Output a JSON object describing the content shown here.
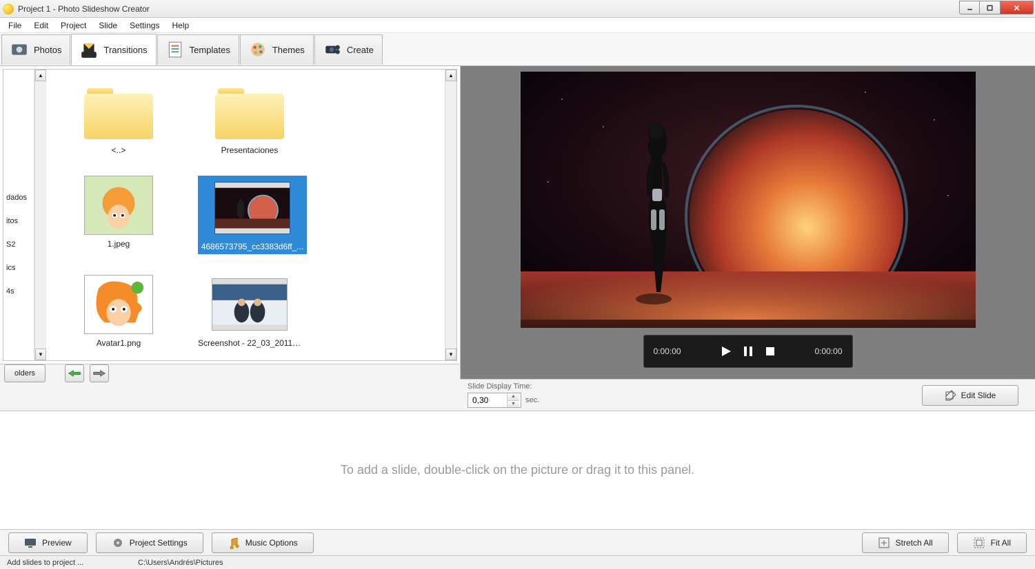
{
  "window": {
    "title": "Project 1 - Photo Slideshow Creator"
  },
  "menu": {
    "items": [
      "File",
      "Edit",
      "Project",
      "Slide",
      "Settings",
      "Help"
    ]
  },
  "tabs": [
    {
      "label": "Photos",
      "active": false
    },
    {
      "label": "Transitions",
      "active": true
    },
    {
      "label": "Templates",
      "active": false
    },
    {
      "label": "Themes",
      "active": false
    },
    {
      "label": "Create",
      "active": false
    }
  ],
  "sidebar_folders": [
    "dados",
    "itos",
    "S2",
    "ics",
    "4s"
  ],
  "files": [
    {
      "label": "<..>",
      "type": "folder",
      "selected": false
    },
    {
      "label": "Presentaciones",
      "type": "folder",
      "selected": false
    },
    {
      "label": "1.jpeg",
      "type": "image",
      "kind": "fry",
      "selected": false
    },
    {
      "label": "4686573795_cc3383d6ff_...",
      "type": "image",
      "kind": "mass",
      "selected": true
    },
    {
      "label": "Avatar1.png",
      "type": "image",
      "kind": "fry2",
      "selected": false
    },
    {
      "label": "Screenshot - 22_03_2011 ...",
      "type": "image",
      "kind": "group",
      "selected": false
    }
  ],
  "folders_button": "olders",
  "player": {
    "elapsed": "0:00:00",
    "total": "0:00:00"
  },
  "slide_display": {
    "label": "Slide Display Time:",
    "value": "0,30",
    "unit": "sec."
  },
  "edit_slide": "Edit Slide",
  "timeline_hint": "To add a slide, double-click on the picture or drag it to this panel.",
  "bottom_buttons": {
    "preview": "Preview",
    "settings": "Project Settings",
    "music": "Music Options",
    "stretch": "Stretch All",
    "fit": "Fit All"
  },
  "status": {
    "left": "Add slides to project ...",
    "path": "C:\\Users\\Andrés\\Pictures"
  }
}
